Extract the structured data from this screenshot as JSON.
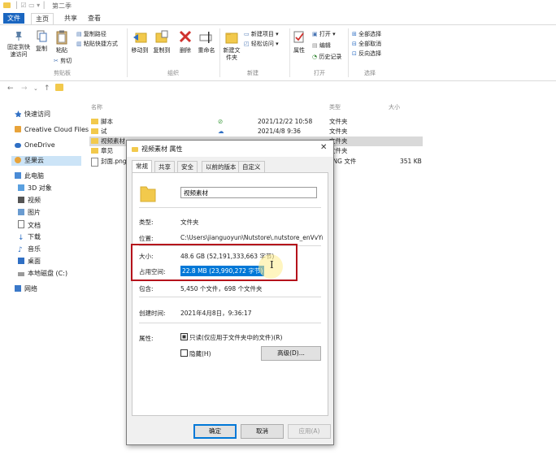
{
  "window": {
    "title": "第二季"
  },
  "ribbon": {
    "tabs": [
      {
        "label": "文件"
      },
      {
        "label": "主页"
      },
      {
        "label": "共享"
      },
      {
        "label": "查看"
      }
    ],
    "clipboard": {
      "pin_label": "固定到快速访问",
      "copy_label": "复制",
      "paste_label": "粘贴",
      "copy_path_label": "复制路径",
      "paste_shortcut_label": "粘贴快捷方式",
      "cut_label": "剪切",
      "group_label": "剪贴板"
    },
    "organize": {
      "move_to_label": "移动到",
      "copy_to_label": "复制到",
      "delete_label": "删除",
      "rename_label": "重命名",
      "group_label": "组织"
    },
    "new": {
      "new_folder_label": "新建文件夹",
      "new_item_label": "新建项目 ▾",
      "easy_access_label": "轻松访问 ▾",
      "group_label": "新建"
    },
    "open": {
      "properties_label": "属性",
      "open_label": "打开 ▾",
      "edit_label": "编辑",
      "history_label": "历史记录",
      "group_label": "打开"
    },
    "select": {
      "select_all_label": "全部选择",
      "select_none_label": "全部取消",
      "invert_label": "反向选择",
      "group_label": "选择"
    }
  },
  "nav": {
    "items": [
      {
        "label": "快速访问"
      },
      {
        "label": "Creative Cloud Files"
      },
      {
        "label": "OneDrive"
      },
      {
        "label": "坚果云"
      },
      {
        "label": "此电脑"
      },
      {
        "label": "3D 对象"
      },
      {
        "label": "视频"
      },
      {
        "label": "图片"
      },
      {
        "label": "文档"
      },
      {
        "label": "下载"
      },
      {
        "label": "音乐"
      },
      {
        "label": "桌面"
      },
      {
        "label": "本地磁盘 (C:)"
      },
      {
        "label": "网络"
      }
    ]
  },
  "file_list": {
    "headers": {
      "name": "名称",
      "type": "类型",
      "size": "大小"
    },
    "rows": [
      {
        "name": "脚本",
        "date": "2021/12/22 10:58",
        "type": "文件夹",
        "size": ""
      },
      {
        "name": "试",
        "date": "2021/4/8 9:36",
        "type": "文件夹",
        "size": ""
      },
      {
        "name": "视频素材",
        "date": "",
        "type": "文件夹",
        "size": ""
      },
      {
        "name": "章见",
        "date": "",
        "type": "文件夹",
        "size": ""
      },
      {
        "name": "封面.png",
        "date": "",
        "type": "PNG 文件",
        "size": "351 KB"
      }
    ]
  },
  "dialog": {
    "title": "视频素材 属性",
    "close_glyph": "✕",
    "tabs": [
      {
        "label": "常规"
      },
      {
        "label": "共享"
      },
      {
        "label": "安全"
      },
      {
        "label": "以前的版本"
      },
      {
        "label": "自定义"
      }
    ],
    "name_value": "视频素材",
    "fields": {
      "type_label": "类型:",
      "type_value": "文件夹",
      "location_label": "位置:",
      "location_value": "C:\\Users\\jianguoyun\\Nutstore\\.nutstore_enVvYmlı",
      "size_label": "大小:",
      "size_value": "48.6 GB (52,191,333,663 字节)",
      "disk_size_label": "占用空间:",
      "disk_size_value": "22.8 MB (23,990,272 字节)",
      "contains_label": "包含:",
      "contains_value": "5,450 个文件，698 个文件夹",
      "created_label": "创建时间:",
      "created_value": "2021年4月8日，9:36:17",
      "attributes_label": "属性:",
      "readonly_label": "只读(仅应用于文件夹中的文件)(R)",
      "hidden_label": "隐藏(H)",
      "advanced_label": "高级(D)..."
    },
    "buttons": {
      "ok": "确定",
      "cancel": "取消",
      "apply": "应用(A)"
    },
    "highlight_color": "#b5121b"
  }
}
